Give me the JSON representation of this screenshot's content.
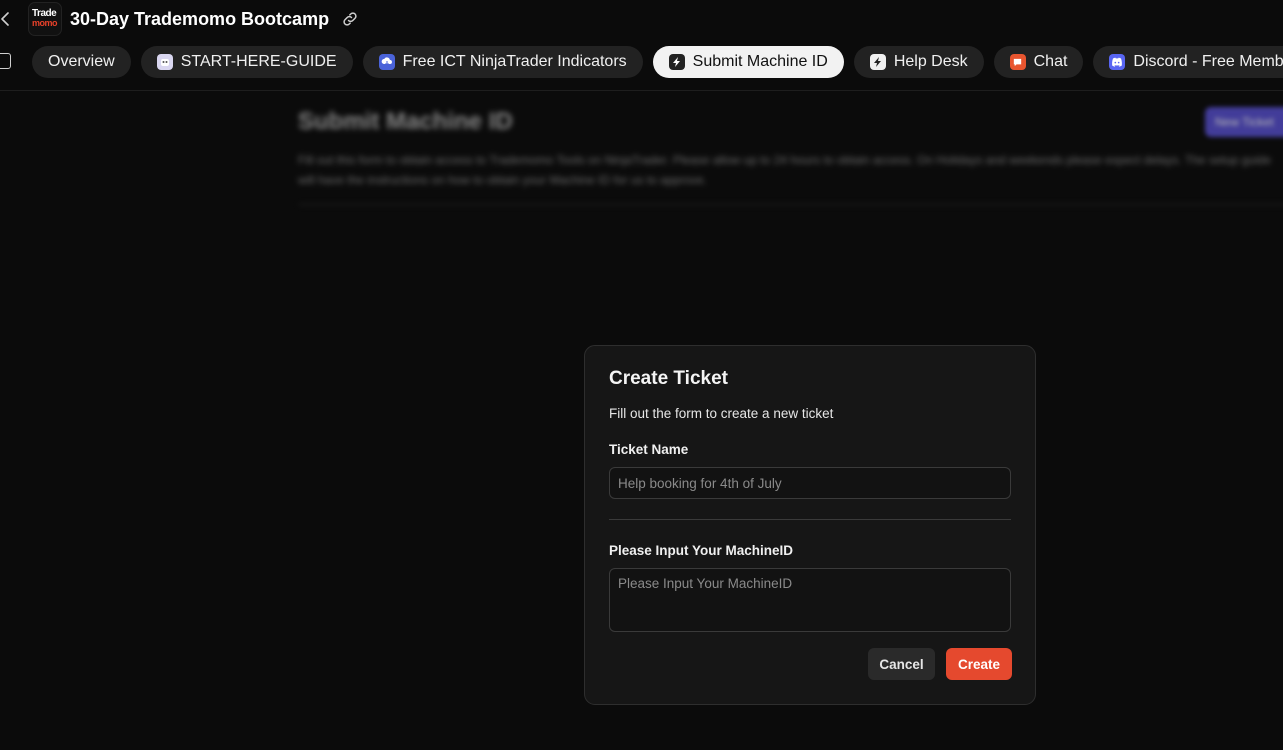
{
  "header": {
    "logo_top": "Trade",
    "logo_bottom": "momo",
    "title": "30-Day Trademomo Bootcamp"
  },
  "tabs": [
    {
      "label": "Overview",
      "icon": "",
      "active": false
    },
    {
      "label": "START-HERE-GUIDE",
      "icon": "robot-face-icon",
      "active": false
    },
    {
      "label": "Free ICT NinjaTrader Indicators",
      "icon": "cloud-download-icon",
      "active": false
    },
    {
      "label": "Submit Machine ID",
      "icon": "bolt-icon",
      "active": true
    },
    {
      "label": "Help Desk",
      "icon": "bolt-icon",
      "active": false
    },
    {
      "label": "Chat",
      "icon": "chat-bubble-icon",
      "active": false
    },
    {
      "label": "Discord - Free Members",
      "icon": "discord-icon",
      "active": false
    }
  ],
  "background": {
    "title": "Submit Machine ID",
    "description": "Fill out this form to obtain access to Trademomo Tools on NinjaTrader. Please allow up to 24 hours to obtain access. On Holidays and weekends please expect delays. The setup guide will have the instructions on how to obtain your Machine ID for us to approve.",
    "button": "New Ticket"
  },
  "modal": {
    "title": "Create Ticket",
    "subtitle": "Fill out the form to create a new ticket",
    "ticket_name_label": "Ticket Name",
    "ticket_name_placeholder": "Help booking for 4th of July",
    "ticket_name_value": "",
    "machine_label": "Please Input Your MachineID",
    "machine_placeholder": "Please Input Your MachineID",
    "machine_value": "",
    "cancel_label": "Cancel",
    "create_label": "Create"
  },
  "colors": {
    "accent": "#e5492e",
    "background": "#0b0b0b",
    "tab_bg": "#222222",
    "tab_active_bg": "#f2f2f2"
  }
}
